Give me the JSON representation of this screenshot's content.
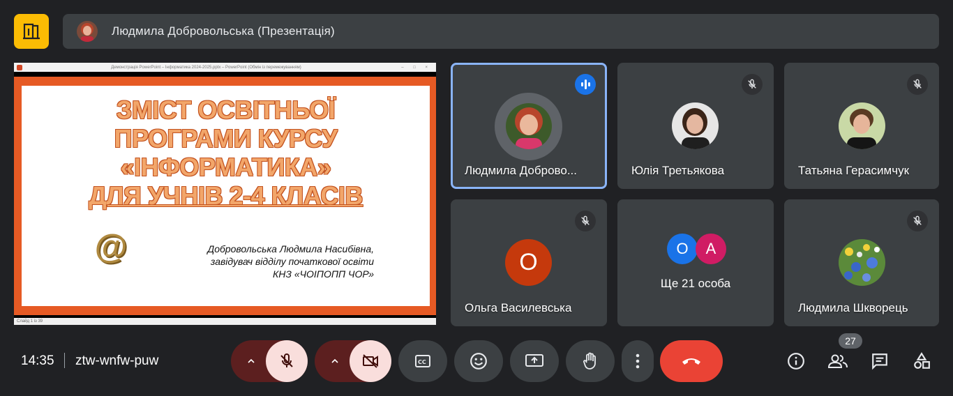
{
  "presenter_bar": {
    "title": "Людмила Добровольська (Презентація)"
  },
  "shared_screen": {
    "window_title": "Демонстрація PowerPoint – Інформатика 2024-2025.pptx – PowerPoint (Обмін із перемежуванням)",
    "window_controls": "– □ ×",
    "status_left": "Слайд 1 із 39",
    "slide": {
      "title_lines": [
        "ЗМІСТ ОСВІТНЬОЇ",
        "ПРОГРАМИ КУРСУ",
        "«ІНФОРМАТИКА»",
        "ДЛЯ УЧНІВ 2-4 КЛАСІВ"
      ],
      "logo_glyph": "@",
      "author_lines": [
        "Добровольська Людмила Насибівна,",
        "завідувач відділу початкової освіти",
        "КНЗ «ЧОІПОПП ЧОР»"
      ]
    }
  },
  "tiles": [
    {
      "name": "Людмила Доброво...",
      "status": "speaking"
    },
    {
      "name": "Юлія Третьякова",
      "status": "muted"
    },
    {
      "name": "Татьяна Герасимчук",
      "status": "muted"
    },
    {
      "name": "Ольга Василевська",
      "status": "muted",
      "avatar_letter": "О",
      "avatar_color": "#c5390c"
    },
    {
      "name": "Ще 21 особа",
      "avatar_letters": [
        "О",
        "А"
      ],
      "avatar_colors": [
        "#1a73e8",
        "#d01c64"
      ]
    },
    {
      "name": "Людмила Шкворець",
      "status": "muted"
    }
  ],
  "bottom_bar": {
    "time": "14:35",
    "meeting_code": "ztw-wnfw-puw",
    "people_count": "27"
  },
  "colors": {
    "background": "#202124",
    "tile": "#3c4043",
    "accent_blue": "#8ab4f8",
    "end_call": "#ea4335",
    "logo_yellow": "#fbbc04"
  }
}
